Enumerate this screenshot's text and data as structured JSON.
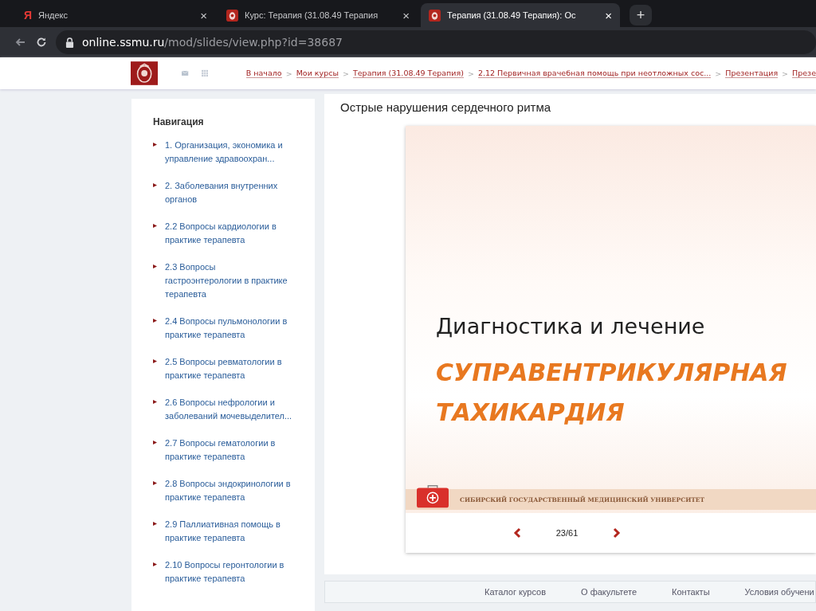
{
  "browser": {
    "tabs": [
      {
        "title": "Яндекс",
        "kind": "yandex",
        "logo": "Я",
        "selected": false
      },
      {
        "title": "Курс: Терапия (31.08.49 Терапия",
        "kind": "site",
        "selected": false
      },
      {
        "title": "Терапия (31.08.49 Терапия): Ос",
        "kind": "site",
        "selected": true
      }
    ],
    "new_tab": "+",
    "close": "×",
    "url": {
      "host": "online.ssmu.ru",
      "path": "/mod/slides/view.php?id=38687"
    }
  },
  "header": {
    "breadcrumbs": [
      "В начало",
      "Мои курсы",
      "Терапия (31.08.49 Терапия)",
      "2.12 Первичная врачебная помощь при неотложных сос...",
      "Презентация",
      "Презе"
    ],
    "separator": ">"
  },
  "navigation": {
    "title": "Навигация",
    "items": [
      "1. Организация, экономика и управление здравоохран...",
      "2. Заболевания внутренних органов",
      "2.2 Вопросы кардиологии в практике терапевта",
      "2.3 Вопросы гастроэнтерологии в практике терапевта",
      "2.4 Вопросы пульмонологии в практике терапевта",
      "2.5 Вопросы ревматологии в практике терапевта",
      "2.6 Вопросы нефрологии и заболеваний мочевыделител...",
      "2.7 Вопросы гематологии в практике терапевта",
      "2.8 Вопросы эндокринологии в практике терапевта",
      "2.9 Паллиативная помощь в практике терапевта",
      "2.10 Вопросы геронтологии в практике терапевта"
    ]
  },
  "page_title": "Острые нарушения сердечного ритма",
  "slide": {
    "subtitle": "Диагностика и лечение",
    "title_lines": [
      "СУПРАВЕНТРИКУЛЯРНАЯ",
      "ТАХИКАРДИЯ"
    ],
    "footer": "СИБИРСКИЙ ГОСУДАРСТВЕННЫЙ МЕДИЦИНСКИЙ УНИВЕРСИТЕТ"
  },
  "pager": "23/61",
  "footer_links": [
    "Каталог курсов",
    "О факультете",
    "Контакты",
    "Условия обучени"
  ]
}
